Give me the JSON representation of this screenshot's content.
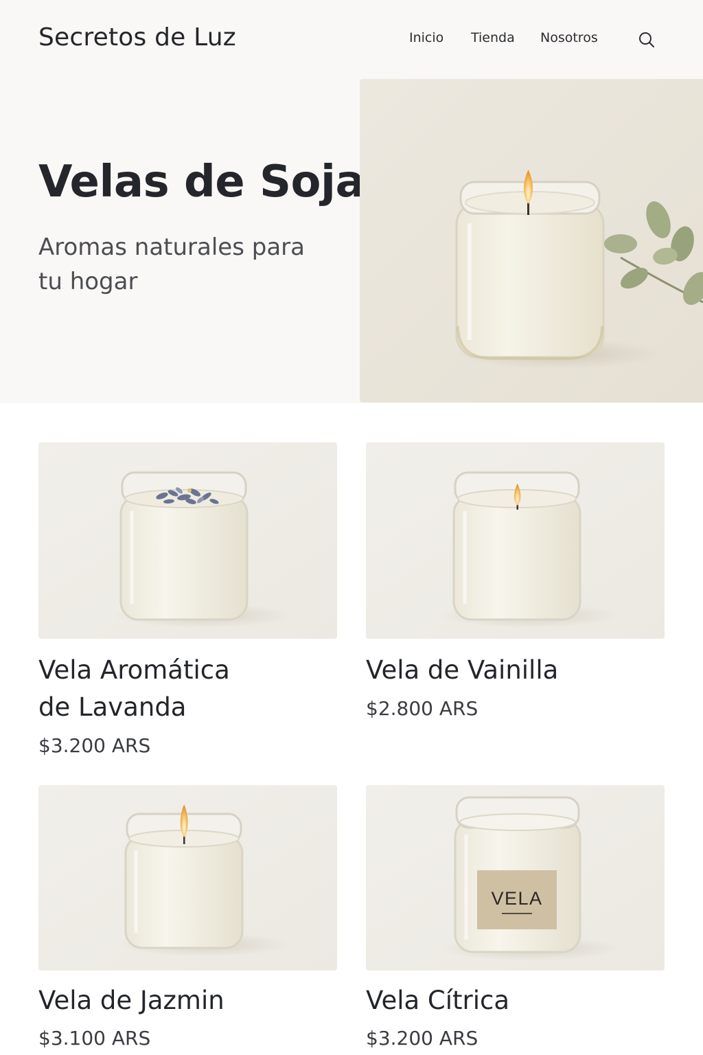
{
  "brand": "Secretos de Luz",
  "nav": {
    "items": [
      "Inicio",
      "Tienda",
      "Nosotros"
    ]
  },
  "search": {
    "icon": "search-icon"
  },
  "hero": {
    "title": "Velas de Soja",
    "subtitle": "Aromas naturales para tu hogar"
  },
  "products": [
    {
      "name": "Vela Aromática de Lavanda",
      "price": "$3.200 ARS"
    },
    {
      "name": "Vela de Vainilla",
      "price": "$2.800 ARS"
    },
    {
      "name": "Vela de Jazmin",
      "price": "$3.100 ARS"
    },
    {
      "name": "Vela Cítrica",
      "price": "$3.200 ARS",
      "label": "VELA"
    }
  ],
  "colors": {
    "background": "#ffffff",
    "header_bg": "#f9f8f6",
    "text": "#24262b",
    "subtitle": "#4b4d52",
    "wax": "#f3efe2",
    "label": "#cfc0a4"
  }
}
